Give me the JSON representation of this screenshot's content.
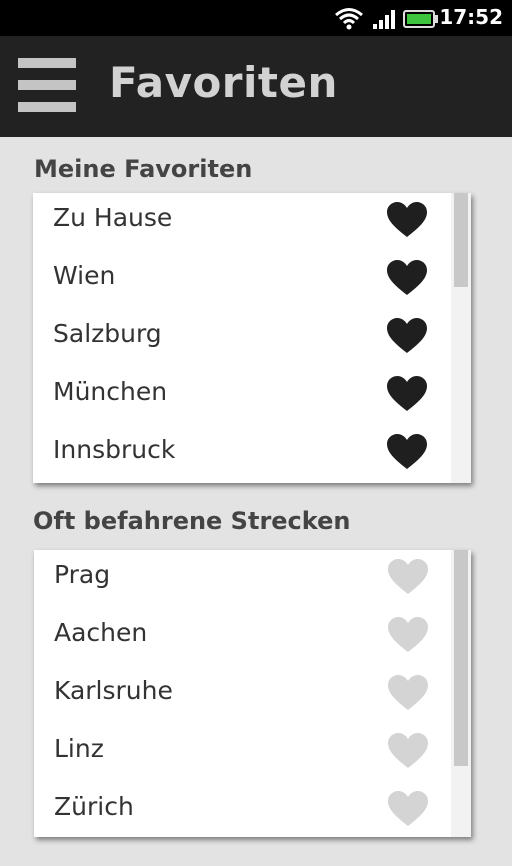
{
  "status_bar": {
    "time": "17:52",
    "icons": [
      "wifi-icon",
      "signal-icon",
      "battery-icon"
    ],
    "battery_color": "#3fc43f"
  },
  "app_bar": {
    "title": "Favoriten",
    "menu_icon": "menu-icon"
  },
  "favorites": {
    "heading": "Meine Favoriten",
    "items": [
      {
        "label": "Zu Hause",
        "favorited": true
      },
      {
        "label": "Wien",
        "favorited": true
      },
      {
        "label": "Salzburg",
        "favorited": true
      },
      {
        "label": "München",
        "favorited": true
      },
      {
        "label": "Innsbruck",
        "favorited": true
      }
    ]
  },
  "frequent": {
    "heading": "Oft befahrene Strecken",
    "items": [
      {
        "label": "Prag",
        "favorited": false
      },
      {
        "label": "Aachen",
        "favorited": false
      },
      {
        "label": "Karlsruhe",
        "favorited": false
      },
      {
        "label": "Linz",
        "favorited": false
      },
      {
        "label": "Zürich",
        "favorited": false
      }
    ]
  },
  "colors": {
    "heart_filled": "#1f1f1f",
    "heart_empty": "#d4d4d4",
    "app_bar_bg": "#222222"
  }
}
